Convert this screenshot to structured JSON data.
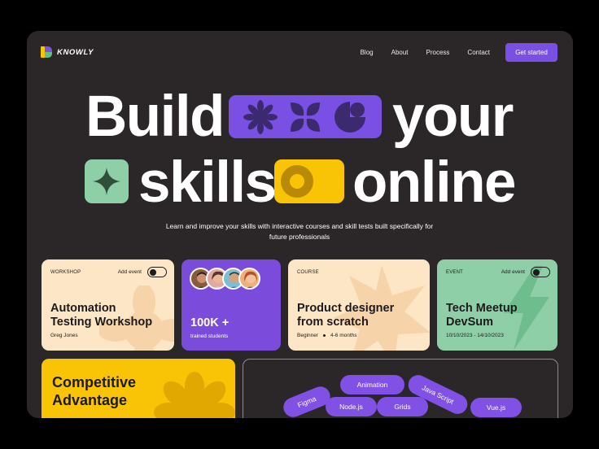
{
  "brand": {
    "name": "KNOWLY"
  },
  "nav": {
    "links": [
      "Blog",
      "About",
      "Process",
      "Contact"
    ],
    "cta": "Get started"
  },
  "hero": {
    "line1_left": "Build",
    "line1_right": "your",
    "line2_left": "skills",
    "line2_right": "online",
    "subtitle": "Learn and improve your skills with interactive courses and skill tests built specifically for future professionals"
  },
  "cards": {
    "workshop": {
      "tag": "WORKSHOP",
      "toggle_label": "Add event",
      "title": "Automation Testing Workshop",
      "title_l1": "Automation",
      "title_l2": "Testing Workshop",
      "author": "Greg Jones"
    },
    "students": {
      "count": "100K +",
      "label": "trained students"
    },
    "course": {
      "tag": "COURSE",
      "title_l1": "Product designer",
      "title_l2": "from scratch",
      "level": "Beginner",
      "duration": "4-6 months"
    },
    "event": {
      "tag": "EVENT",
      "toggle_label": "Add event",
      "title_l1": "Tech Meetup",
      "title_l2": "DevSum",
      "dates": "10/10/2023 - 14/10/2023"
    },
    "advantage": {
      "title_l1": "Competitive",
      "title_l2": "Advantage"
    },
    "skills": [
      "Figma",
      "Animation",
      "Java Script",
      "Node.js",
      "Grids",
      "Vue.js"
    ]
  },
  "colors": {
    "background": "#2b2628",
    "accent_purple": "#7a4fe3",
    "accent_yellow": "#f9c406",
    "accent_green": "#8fcfa8",
    "cream": "#fde9cc"
  }
}
